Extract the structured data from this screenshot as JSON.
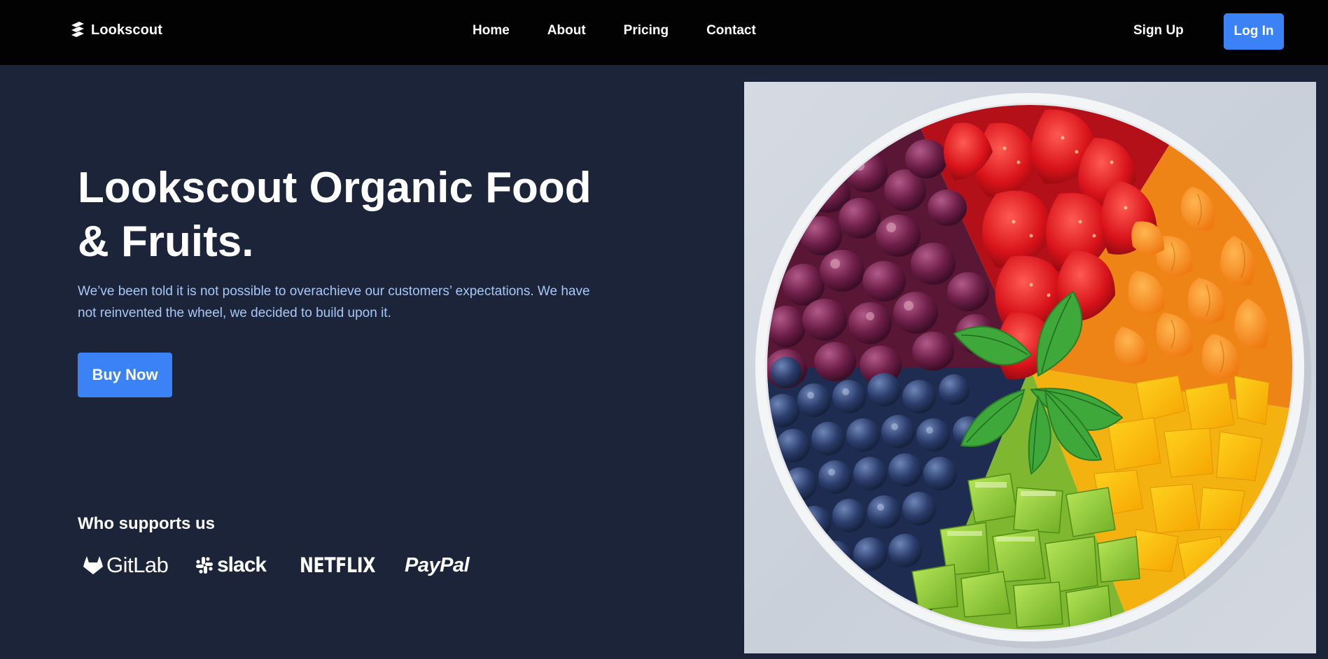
{
  "brand": {
    "name": "Lookscout",
    "icon": "stack-layers-icon"
  },
  "nav": {
    "links": [
      {
        "label": "Home"
      },
      {
        "label": "About"
      },
      {
        "label": "Pricing"
      },
      {
        "label": "Contact"
      }
    ],
    "signup_label": "Sign Up",
    "login_label": "Log In"
  },
  "hero": {
    "title_line1": "Lookscout Organic Food",
    "title_line2": "& Fruits.",
    "description_line1": "We’ve been told it is not possible to overachieve our customers’ expectations. We have",
    "description_line2": "not reinvented the wheel, we decided to build upon it.",
    "cta_label": "Buy Now"
  },
  "supporters": {
    "title": "Who supports us",
    "logos": [
      {
        "name": "GitLab",
        "icon": "gitlab-fox-icon"
      },
      {
        "name": "slack",
        "icon": "slack-hash-icon"
      },
      {
        "name": "NETFLIX"
      },
      {
        "name": "PayPal"
      }
    ]
  },
  "image": {
    "subject": "fruit-bowl-image"
  },
  "colors": {
    "navbar_bg": "#020203",
    "page_bg": "#1b2438",
    "accent": "#3b82f6",
    "description_text": "#a9c7f6"
  }
}
